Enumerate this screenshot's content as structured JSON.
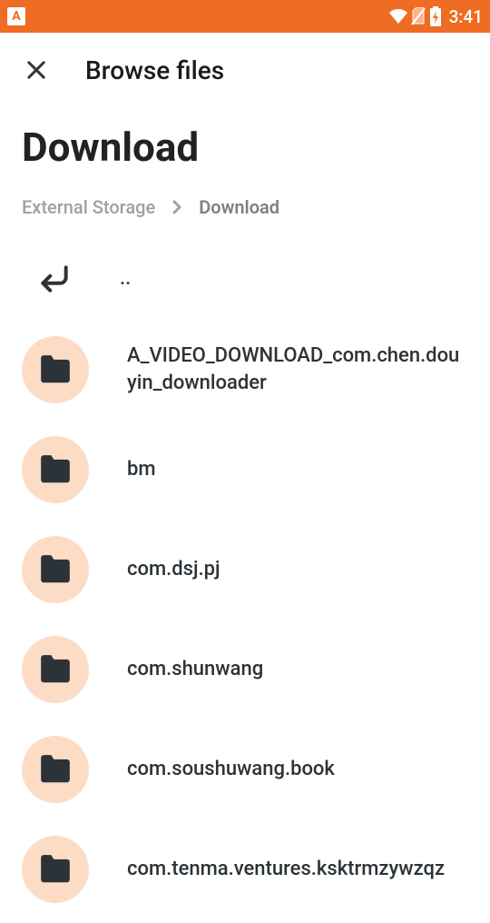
{
  "statusbar": {
    "app_indicator": "A",
    "time": "3:41"
  },
  "toolbar": {
    "title": "Browse files"
  },
  "page": {
    "title": "Download"
  },
  "breadcrumb": {
    "root": "External Storage",
    "current": "Download"
  },
  "files": {
    "up_label": "..",
    "items": [
      "A_VIDEO_DOWNLOAD_com.chen.douyin_downloader",
      "bm",
      "com.dsj.pj",
      "com.shunwang",
      "com.soushuwang.book",
      "com.tenma.ventures.ksktrmzywzqz"
    ]
  }
}
